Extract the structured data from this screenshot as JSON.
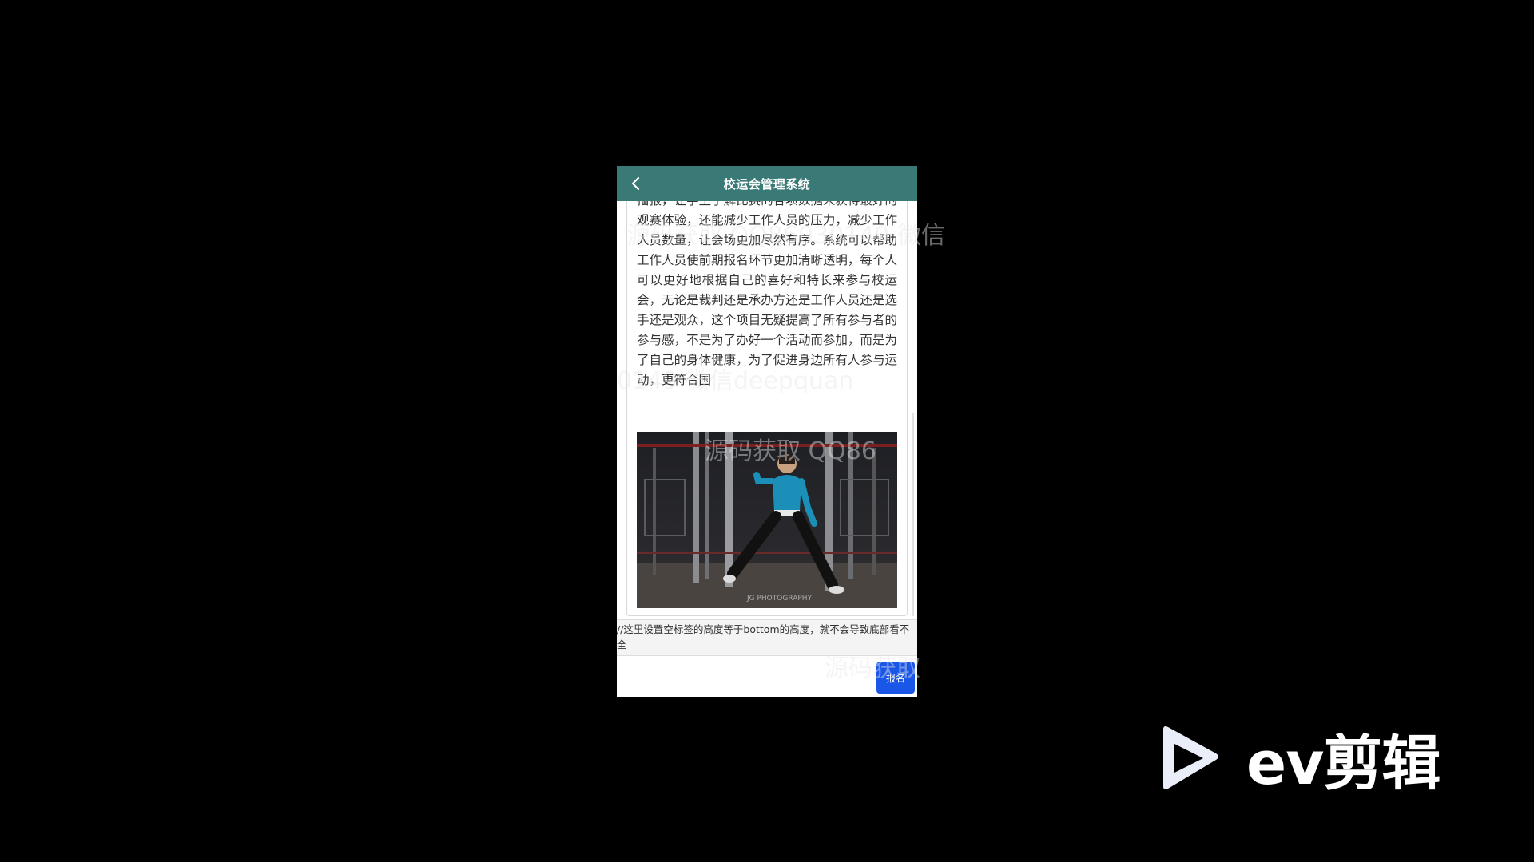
{
  "app": {
    "title": "校运会管理系统"
  },
  "article": {
    "text": "播报，让学生了解比赛的各项数据来获得最好的观赛体验，还能减少工作人员的压力，减少工作人员数量，让会场更加尽然有序。系统可以帮助工作人员使前期报名环节更加清晰透明，每个人可以更好地根据自己的喜好和特长来参与校运会，无论是裁判还是承办方还是工作人员还是选手还是观众，这个项目无疑提高了所有参与者的参与感，不是为了办好一个活动而参加，而是为了自己的身体健康，为了促进身边所有人参与运动，更符合国"
  },
  "photo": {
    "caption": "JG PHOTOGRAPHY"
  },
  "note": {
    "text": "//这里设置空标签的高度等于bottom的高度，就不会导致底部看不全"
  },
  "buttons": {
    "signup_label": "报名"
  },
  "watermarks": {
    "wm1": "源码获取 QQ86030149 微信",
    "wm2": "0149 微信deepquan",
    "wm3": "源码获取 QQ86",
    "wm4": "源码获取"
  },
  "overlay": {
    "brand_text": "ev剪辑"
  },
  "colors": {
    "header_bg": "#3a7a76",
    "button_bg": "#1a56e8",
    "background": "#000000"
  },
  "icons": {
    "back": "chevron-left-icon",
    "logo": "play-triangle-icon"
  }
}
